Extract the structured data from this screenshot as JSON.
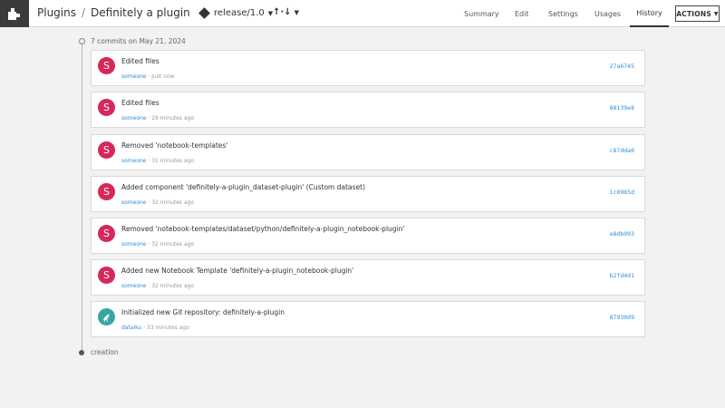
{
  "header": {
    "breadcrumb_root": "Plugins",
    "breadcrumb_separator": "/",
    "breadcrumb_current": "Definitely a plugin",
    "branch": "release/1.0",
    "sync_label": "↑·↓",
    "tabs": [
      {
        "label": "Summary"
      },
      {
        "label": "Edit"
      },
      {
        "label": "Settings"
      },
      {
        "label": "Usages"
      },
      {
        "label": "History",
        "active": true
      }
    ],
    "actions_label": "ACTIONS"
  },
  "history": {
    "group_label": "7 commits on May 21, 2024",
    "end_label": "creation",
    "commits": [
      {
        "avatar": "S",
        "message": "Edited files",
        "author": "someone",
        "time": " · just now",
        "hash": "27a6745"
      },
      {
        "avatar": "S",
        "message": "Edited files",
        "author": "someone",
        "time": " · 29 minutes ago",
        "hash": "88139e8"
      },
      {
        "avatar": "S",
        "message": "Removed 'notebook-templates'",
        "author": "someone",
        "time": " · 31 minutes ago",
        "hash": "c87dda0"
      },
      {
        "avatar": "S",
        "message": "Added component 'definitely-a-plugin_dataset-plugin' (Custom dataset)",
        "author": "someone",
        "time": " · 32 minutes ago",
        "hash": "1c8965d"
      },
      {
        "avatar": "S",
        "message": "Removed 'notebook-templates/dataset/python/definitely-a-plugin_notebook-plugin'",
        "author": "someone",
        "time": " · 32 minutes ago",
        "hash": "e8db093"
      },
      {
        "avatar": "S",
        "message": "Added new Notebook Template 'definitely-a-plugin_notebook-plugin'",
        "author": "someone",
        "time": " · 32 minutes ago",
        "hash": "b2fd4d1"
      },
      {
        "avatar": "",
        "message": "Initialized new Git repository: definitely-a-plugin",
        "author": "dataiku",
        "time": " · 33 minutes ago",
        "hash": "87930d9"
      }
    ]
  },
  "colors": {
    "accent": "#2d8fd5",
    "avatar_user": "#d6285a",
    "avatar_system": "#3aa6a1"
  },
  "icons": {
    "app": "puzzle-icon",
    "branch": "git-branch-icon",
    "system_avatar": "bird-icon"
  }
}
